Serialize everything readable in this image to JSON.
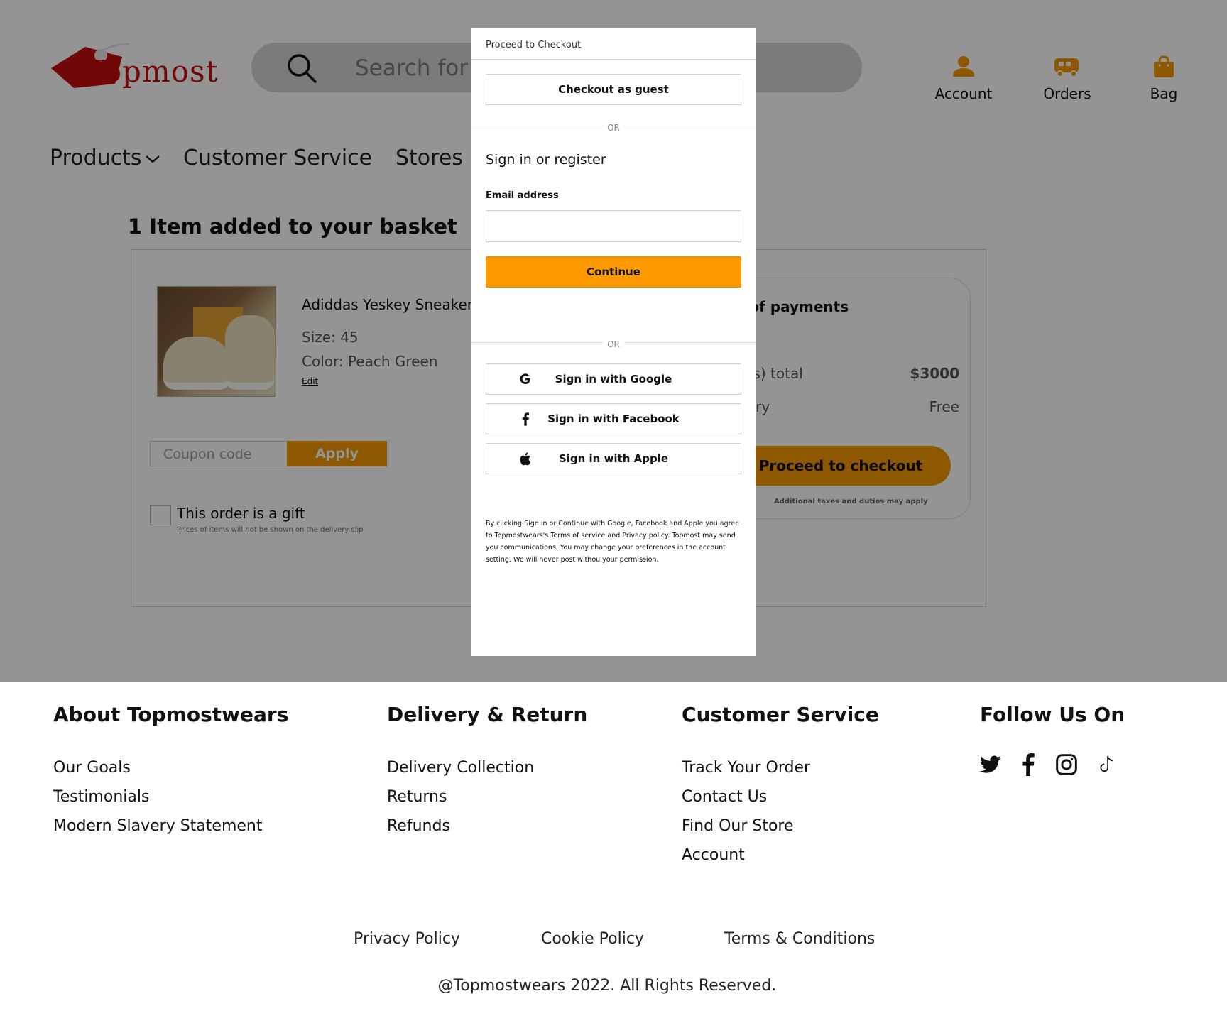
{
  "brand": {
    "name": "Topmost",
    "accent": "#f39800",
    "brand_red": "#c40d0d"
  },
  "header": {
    "search_placeholder": "Search for p",
    "icons": [
      {
        "label": "Account",
        "icon": "person-icon"
      },
      {
        "label": "Orders",
        "icon": "truck-icon"
      },
      {
        "label": "Bag",
        "icon": "bag-icon"
      }
    ]
  },
  "nav": {
    "products": "Products",
    "customer_service": "Customer Service",
    "stores": "Stores"
  },
  "basket": {
    "title": "1 Item added to your basket",
    "product": {
      "name": "Adiddas Yeskey Sneakers",
      "size": "Size: 45",
      "color": "Color: Peach Green",
      "edit": "Edit"
    },
    "coupon_placeholder": "Coupon code",
    "apply_label": "Apply",
    "gift_label": "This order is a gift",
    "gift_note": "Prices of items will not be shown on the delivery slip"
  },
  "summary": {
    "title": "le of payments",
    "items_total_label": "n(s) total",
    "items_total_value": "$3000",
    "delivery_label": "very",
    "delivery_value": "Free",
    "checkout_label": "Proceed to checkout",
    "tax_note": "Additional taxes and duties may apply"
  },
  "modal": {
    "title": "Proceed to Checkout",
    "guest_label": "Checkout as guest",
    "or": "OR",
    "sign_title": "Sign in or register",
    "email_label": "Email address",
    "email_value": "",
    "continue_label": "Continue",
    "google_label": "Sign in with Google",
    "facebook_label": "Sign in with Facebook",
    "apple_label": "Sign in with Apple",
    "legal": "By clicking Sign in or Continue with Google, Facebook and Apple you agree to Topmostwears's Terms of service and Privacy policy. Topmost may send you communications.  You may change your preferences in the account setting. We will never post withou your permission."
  },
  "footer": {
    "about": {
      "title": "About Topmostwears",
      "links": [
        "Our Goals",
        "Testimonials",
        "Modern Slavery Statement"
      ]
    },
    "delivery": {
      "title": "Delivery & Return",
      "links": [
        "Delivery Collection",
        "Returns",
        "Refunds"
      ]
    },
    "service": {
      "title": "Customer Service",
      "links": [
        "Track Your Order",
        "Contact Us",
        "Find Our Store",
        "Account"
      ]
    },
    "follow": {
      "title": "Follow Us On",
      "icons": [
        "twitter-icon",
        "facebook-icon",
        "instagram-icon",
        "tiktok-icon"
      ]
    },
    "privacy": "Privacy Policy",
    "cookie": "Cookie Policy",
    "terms": "Terms & Conditions",
    "copyright": "@Topmostwears 2022. All Rights Reserved."
  }
}
